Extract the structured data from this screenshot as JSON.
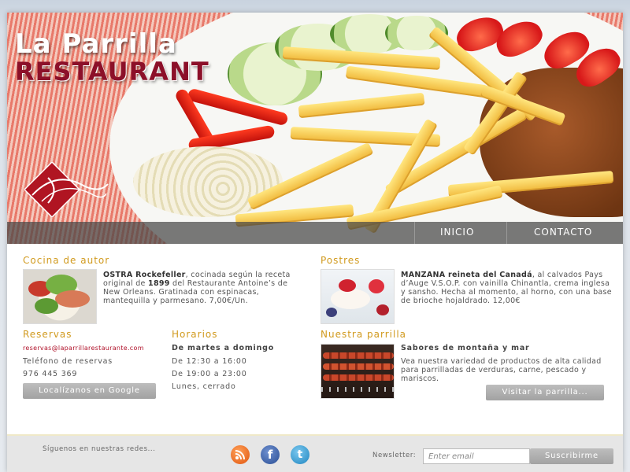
{
  "hero": {
    "title_line1": "La Parrilla",
    "title_line2": "RESTAURANT"
  },
  "nav": {
    "items": [
      {
        "label": "INICIO"
      },
      {
        "label": "CONTACTO"
      }
    ]
  },
  "cocina": {
    "title": "Cocina de autor",
    "dish_name": "OSTRA Rockefeller",
    "text_a": ", cocinada según la receta original de ",
    "year": "1899",
    "text_b": " del Restaurante Antoine’s de New Orleans. Gratinada con espinacas, mantequilla y parmesano.",
    "price": "7,00€/Un."
  },
  "postres": {
    "title": "Postres",
    "dish_name": "MANZANA reineta del Canadá",
    "text": ", al calvados Pays d’Auge V.S.O.P. con vainilla Chinantla, crema inglesa y sansho. Hecha al momento, al horno, con una base de brioche hojaldrado.",
    "price": "12,00€"
  },
  "reservas": {
    "title": "Reservas",
    "email": "reservas@laparrillarestaurante.com",
    "phone_label": "Teléfono de reservas",
    "phone": "976 445 369",
    "map_button": "Localízanos en Google"
  },
  "horarios": {
    "title": "Horarios",
    "days": "De martes a domingo",
    "slot1": "De 12:30 a 16:00",
    "slot2": "De 19:00 a 23:00",
    "closed": "Lunes, cerrado"
  },
  "parrilla": {
    "title": "Nuestra parrilla",
    "subtitle": "Sabores de montaña y mar",
    "text": "Vea nuestra variedad de productos de alta calidad para parrilladas de verduras, carne, pescado y mariscos.",
    "button": "Visitar la parrilla..."
  },
  "footer": {
    "follow_text": "Síguenos en nuestras redes...",
    "social": [
      {
        "icon": "rss-icon",
        "glyph": "◉",
        "color": "#f06a1e"
      },
      {
        "icon": "facebook-icon",
        "glyph": "f",
        "color": "#3b63a8"
      },
      {
        "icon": "twitter-icon",
        "glyph": "t",
        "color": "#38a2d8"
      }
    ],
    "newsletter_label": "Newsletter:",
    "newsletter_placeholder": "Enter email",
    "subscribe_button": "Suscribirme"
  },
  "colors": {
    "accent_gold": "#d19a1e",
    "brand_red": "#8c1029",
    "button_gray": "#a8a8a8"
  }
}
